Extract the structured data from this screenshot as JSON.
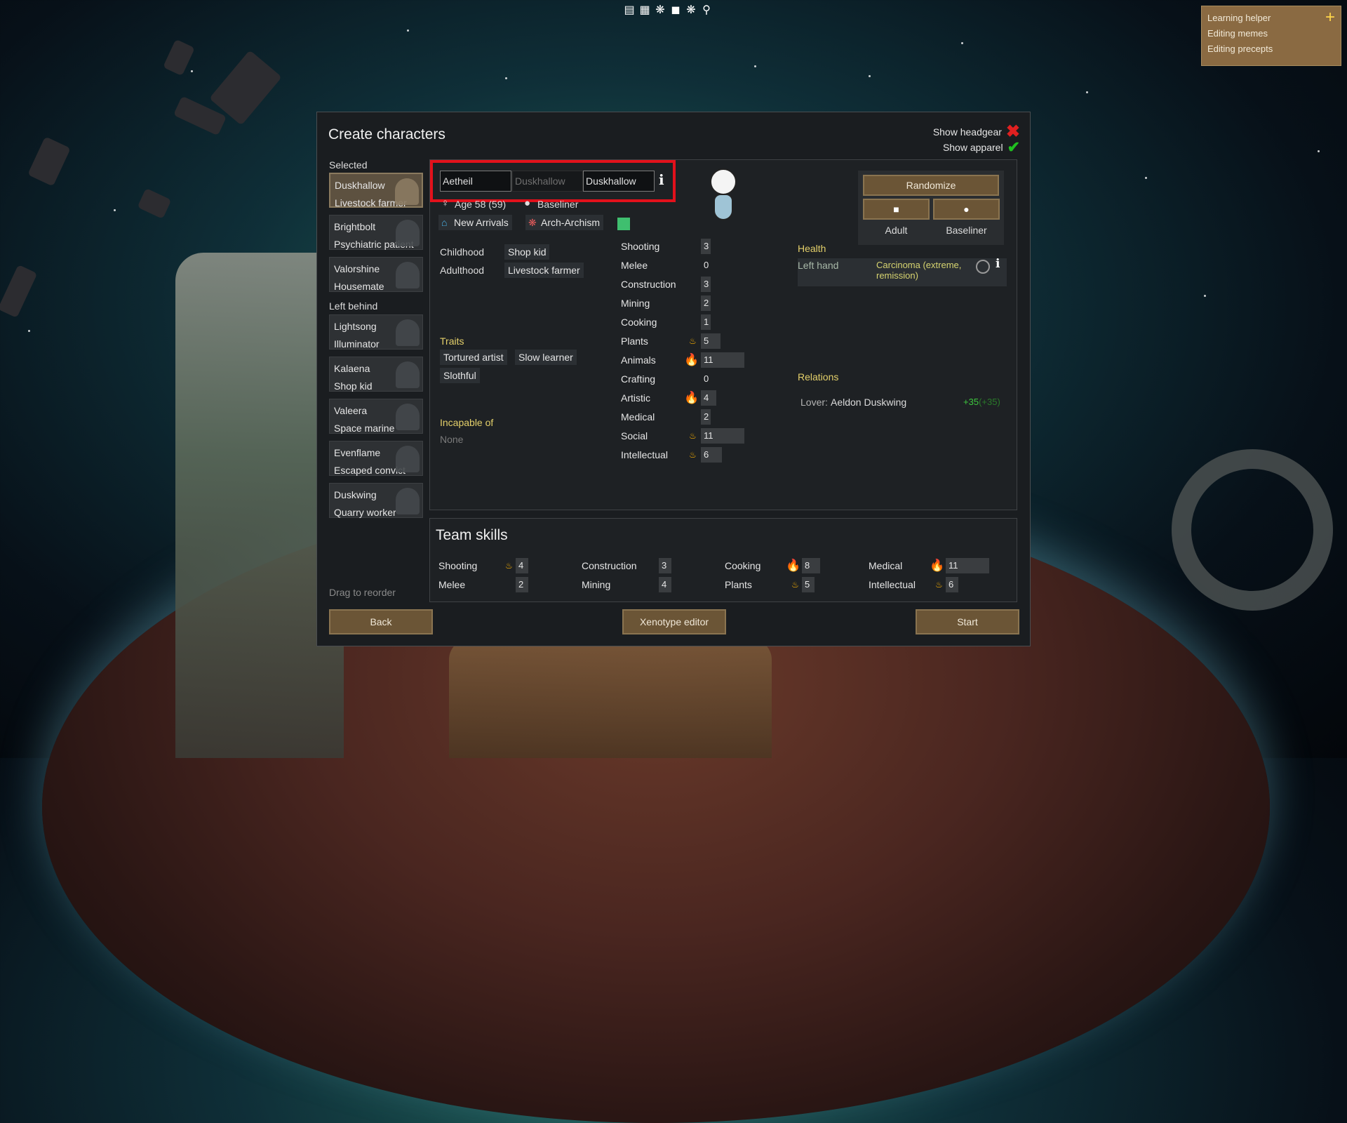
{
  "toolbar_icons": [
    "list-icon",
    "table-icon",
    "gear-icon",
    "bag-icon",
    "settings-icon",
    "search-icon"
  ],
  "learning_helper": {
    "title": "Learning helper",
    "items": [
      "Editing memes",
      "Editing precepts"
    ]
  },
  "dialog": {
    "title": "Create characters",
    "show_headgear": "Show headgear",
    "show_apparel": "Show apparel",
    "selected_label": "Selected",
    "left_behind_label": "Left behind",
    "drag_hint": "Drag to reorder",
    "selected": [
      {
        "name": "Duskhallow",
        "role": "Livestock farmer"
      },
      {
        "name": "Brightbolt",
        "role": "Psychiatric patient"
      },
      {
        "name": "Valorshine",
        "role": "Housemate"
      }
    ],
    "left_behind": [
      {
        "name": "Lightsong",
        "role": "Illuminator"
      },
      {
        "name": "Kalaena",
        "role": "Shop kid"
      },
      {
        "name": "Valeera",
        "role": "Space marine"
      },
      {
        "name": "Evenflame",
        "role": "Escaped convict"
      },
      {
        "name": "Duskwing",
        "role": "Quarry worker"
      }
    ],
    "name_first": "Aetheil",
    "name_nick_placeholder": "Duskhallow",
    "name_last": "Duskhallow",
    "age": "Age 58 (59)",
    "xenotype": "Baseliner",
    "faction": "New Arrivals",
    "ideo": "Arch-Archism",
    "fav_color": "#3fbf6f",
    "childhood_label": "Childhood",
    "childhood": "Shop kid",
    "adulthood_label": "Adulthood",
    "adulthood": "Livestock farmer",
    "traits_label": "Traits",
    "traits": [
      "Tortured artist",
      "Slow learner",
      "Slothful"
    ],
    "incapable_label": "Incapable of",
    "incapable_value": "None",
    "skills": [
      {
        "name": "Shooting",
        "value": "3",
        "passion": 0
      },
      {
        "name": "Melee",
        "value": "0",
        "passion": 0
      },
      {
        "name": "Construction",
        "value": "3",
        "passion": 0
      },
      {
        "name": "Mining",
        "value": "2",
        "passion": 0
      },
      {
        "name": "Cooking",
        "value": "1",
        "passion": 0
      },
      {
        "name": "Plants",
        "value": "5",
        "passion": 1
      },
      {
        "name": "Animals",
        "value": "11",
        "passion": 2
      },
      {
        "name": "Crafting",
        "value": "0",
        "passion": 0
      },
      {
        "name": "Artistic",
        "value": "4",
        "passion": 2
      },
      {
        "name": "Medical",
        "value": "2",
        "passion": 0
      },
      {
        "name": "Social",
        "value": "11",
        "passion": 1
      },
      {
        "name": "Intellectual",
        "value": "6",
        "passion": 1
      }
    ],
    "randomize": "Randomize",
    "life_stage": "Adult",
    "xeno_label": "Baseliner",
    "health_label": "Health",
    "health_part": "Left hand",
    "health_condition": "Carcinoma (extreme, remission)",
    "relations_label": "Relations",
    "relation_type": "Lover:",
    "relation_name": "Aeldon Duskwing",
    "relation_value": "+35",
    "relation_value_paren": "(+35)",
    "team_title": "Team skills",
    "team_skills": [
      {
        "name": "Shooting",
        "value": "4",
        "passion": 1
      },
      {
        "name": "Melee",
        "value": "2",
        "passion": 0
      },
      {
        "name": "Construction",
        "value": "3",
        "passion": 0
      },
      {
        "name": "Mining",
        "value": "4",
        "passion": 0
      },
      {
        "name": "Cooking",
        "value": "8",
        "passion": 2
      },
      {
        "name": "Plants",
        "value": "5",
        "passion": 1
      },
      {
        "name": "Medical",
        "value": "11",
        "passion": 2
      },
      {
        "name": "Intellectual",
        "value": "6",
        "passion": 1
      }
    ],
    "back": "Back",
    "xenotype_editor": "Xenotype editor",
    "start": "Start"
  }
}
